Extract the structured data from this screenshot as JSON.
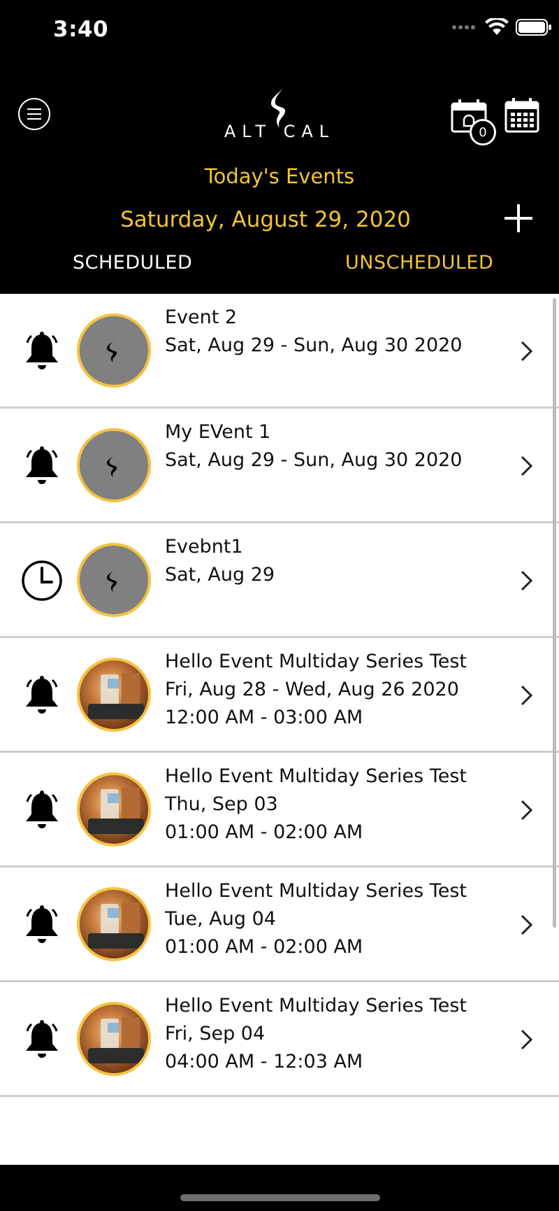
{
  "status_bar": {
    "time": "3:40"
  },
  "header": {
    "logo_text": "ALT CAL",
    "title": "Today's Events",
    "date": "Saturday, August 29, 2020",
    "notification_count": "0",
    "accent_color": "#f2c436"
  },
  "tabs": [
    {
      "label": "SCHEDULED",
      "active": false
    },
    {
      "label": "UNSCHEDULED",
      "active": true
    }
  ],
  "events": [
    {
      "title": "Event 2",
      "date": "Sat, Aug 29 - Sun, Aug 30 2020",
      "time": "",
      "icon": "bell-icon",
      "avatar": "default"
    },
    {
      "title": "My EVent 1",
      "date": "Sat, Aug 29 - Sun, Aug 30 2020",
      "time": "",
      "icon": "bell-icon",
      "avatar": "default"
    },
    {
      "title": "Evebnt1",
      "date": "Sat, Aug 29",
      "time": "",
      "icon": "clock-icon",
      "avatar": "default"
    },
    {
      "title": "Hello Event Multiday Series Test",
      "date": "Fri, Aug 28 - Wed, Aug 26 2020",
      "time": "12:00 AM - 03:00 AM",
      "icon": "bell-icon",
      "avatar": "photo"
    },
    {
      "title": "Hello Event Multiday Series Test",
      "date": "Thu, Sep 03",
      "time": "01:00 AM - 02:00 AM",
      "icon": "bell-icon",
      "avatar": "photo"
    },
    {
      "title": "Hello Event Multiday Series Test",
      "date": "Tue, Aug 04",
      "time": "01:00 AM - 02:00 AM",
      "icon": "bell-icon",
      "avatar": "photo"
    },
    {
      "title": "Hello Event Multiday Series Test",
      "date": "Fri, Sep 04",
      "time": "04:00 AM - 12:03 AM",
      "icon": "bell-icon",
      "avatar": "photo"
    }
  ]
}
